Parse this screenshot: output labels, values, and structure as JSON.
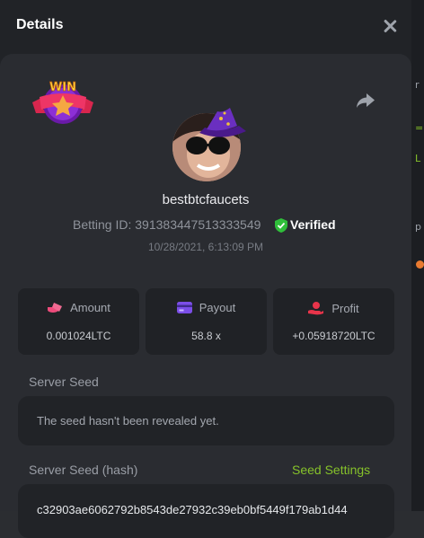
{
  "modal": {
    "title": "Details"
  },
  "player": {
    "username": "bestbtcfaucets",
    "betting_id_label": "Betting ID:",
    "betting_id": "391383447513333549",
    "verified_label": "Verified",
    "datetime": "10/28/2021, 6:13:09 PM",
    "badge_text": "WIN"
  },
  "stats": [
    {
      "label": "Amount",
      "value": "0.001024LTC",
      "icon": "coins-icon"
    },
    {
      "label": "Payout",
      "value": "58.8 x",
      "icon": "card-icon"
    },
    {
      "label": "Profit",
      "value": "+0.05918720LTC",
      "icon": "profit-hand-icon"
    }
  ],
  "server_seed": {
    "label": "Server Seed",
    "value": "The seed hasn't been revealed yet."
  },
  "server_seed_hash": {
    "label": "Server Seed (hash)",
    "settings_link": "Seed Settings",
    "value": "c32903ae6062792b8543de27932c39eb0bf5449f179ab1d44"
  },
  "colors": {
    "accent_green": "#86c22a",
    "verified_green": "#2fbf3a",
    "payout_purple": "#7b4ee8",
    "profit_red": "#e8344a",
    "amount_pink": "#ee4b7b"
  }
}
